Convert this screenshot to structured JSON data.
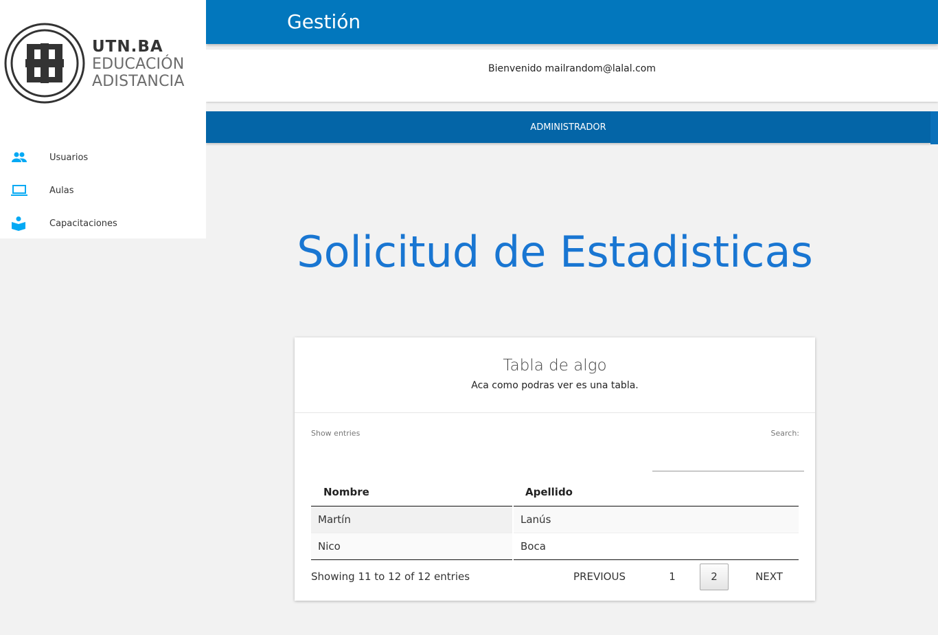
{
  "logo": {
    "line1": "UTN.BA",
    "line2": "EDUCACIÓN",
    "line3": "ADISTANCIA"
  },
  "sidebar": {
    "items": [
      {
        "label": "Usuarios",
        "icon": "people-icon"
      },
      {
        "label": "Aulas",
        "icon": "laptop-icon"
      },
      {
        "label": "Capacitaciones",
        "icon": "book-reader-icon"
      }
    ]
  },
  "header": {
    "title": "Gestión"
  },
  "welcome": "Bienvenido mailrandom@lalal.com",
  "role": "ADMINISTRADOR",
  "page_title": "Solicitud de Estadisticas",
  "card": {
    "title": "Tabla de algo",
    "subtitle": "Aca como podras ver es una tabla.",
    "show_entries": "Show entries",
    "search_label": "Search:",
    "search_value": "",
    "columns": [
      "Nombre",
      "Apellido"
    ],
    "rows": [
      [
        "Martín",
        "Lanús"
      ],
      [
        "Nico",
        "Boca"
      ]
    ],
    "info": "Showing 11 to 12 of 12 entries",
    "pagination": {
      "previous": "PREVIOUS",
      "pages": [
        "1",
        "2"
      ],
      "current": "2",
      "next": "NEXT"
    }
  },
  "colors": {
    "header": "#0277bd",
    "rolebar": "#0465a7",
    "title": "#1976d2",
    "icon": "#03a9f4"
  }
}
